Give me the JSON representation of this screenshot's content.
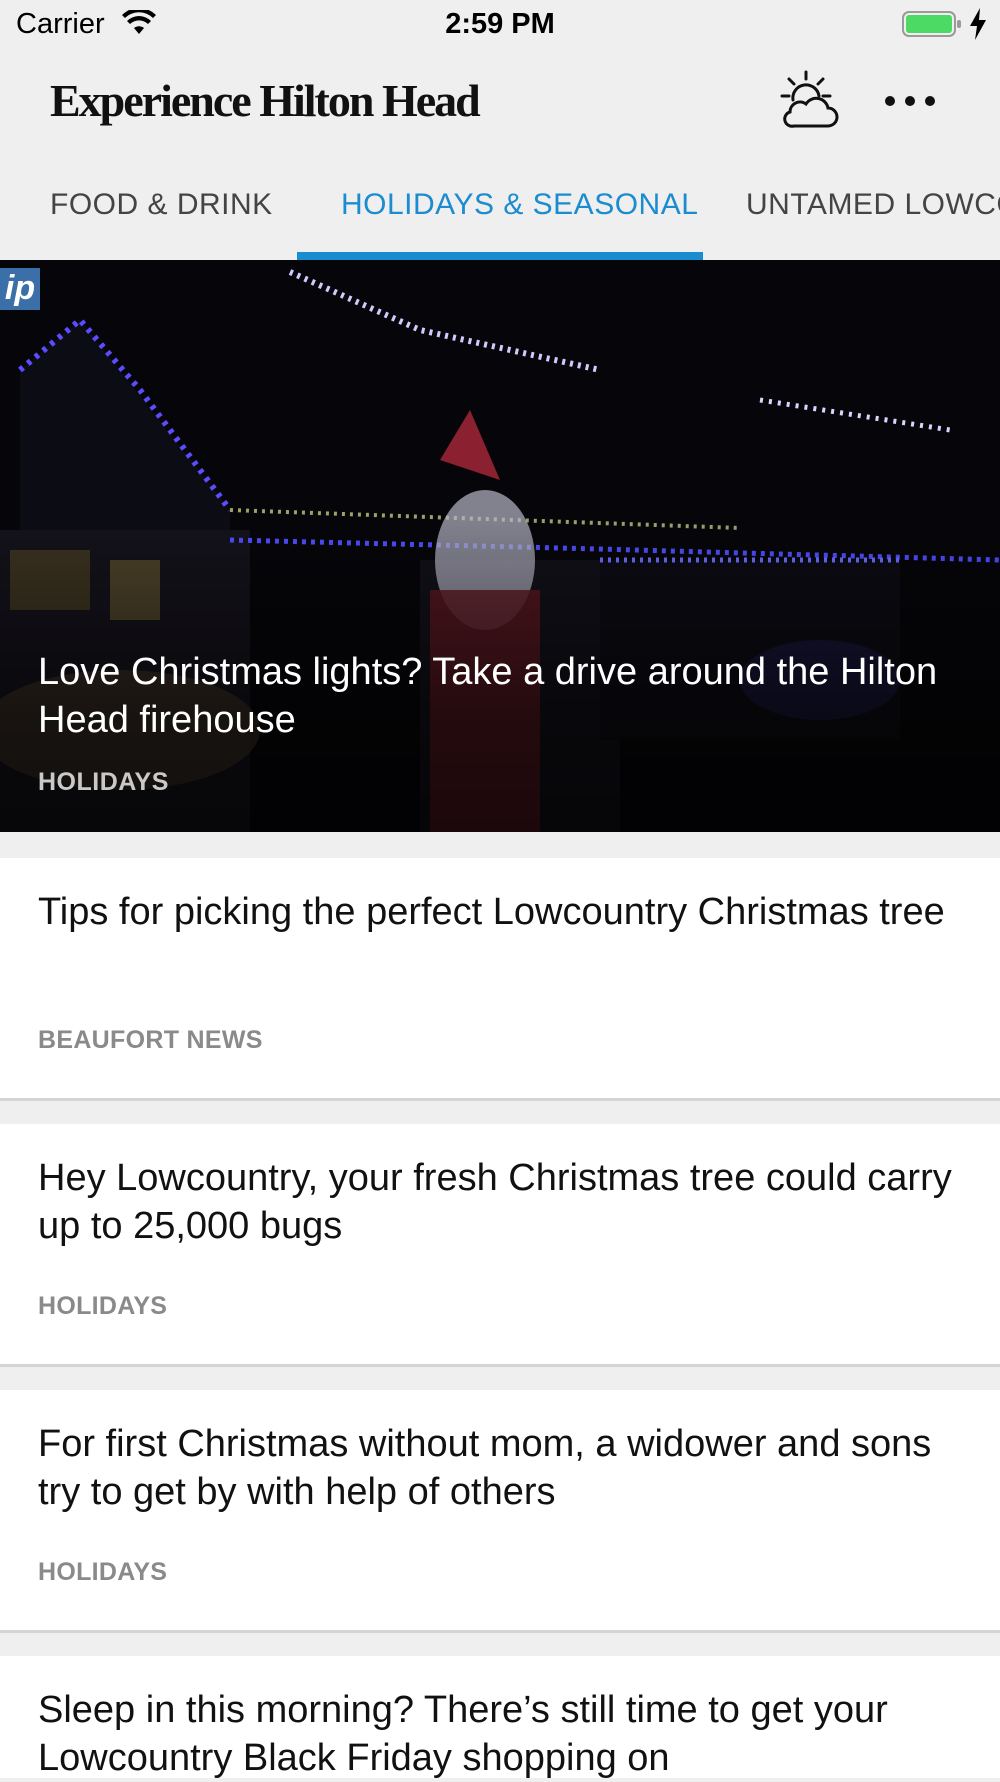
{
  "status_bar": {
    "carrier": "Carrier",
    "time": "2:59 PM"
  },
  "header": {
    "brand": "Experience Hilton Head",
    "weather_icon": "weather-partly-cloudy-icon",
    "more_icon": "more-dots-icon"
  },
  "tabs": [
    {
      "label": "FOOD & DRINK",
      "active": false
    },
    {
      "label": "HOLIDAYS & SEASONAL",
      "active": true
    },
    {
      "label": "UNTAMED LOWCO",
      "active": false
    }
  ],
  "colors": {
    "accent": "#1a8ccf",
    "background": "#efefef",
    "card": "#ffffff",
    "category_text": "#8a8a8a"
  },
  "hero": {
    "badge": "ip",
    "title": "Love Christmas lights? Take a drive around the Hilton Head firehouse",
    "category": "HOLIDAYS"
  },
  "articles": [
    {
      "title": "Tips for picking the perfect Lowcountry Christmas tree",
      "category": "BEAUFORT NEWS"
    },
    {
      "title": "Hey Lowcountry, your fresh Christmas tree could carry up to 25,000 bugs",
      "category": "HOLIDAYS"
    },
    {
      "title": "For first Christmas without mom, a widower and sons try to get by with help of others",
      "category": "HOLIDAYS"
    },
    {
      "title": "Sleep in this morning? There’s still time to get your Lowcountry Black Friday shopping on",
      "category": ""
    }
  ]
}
